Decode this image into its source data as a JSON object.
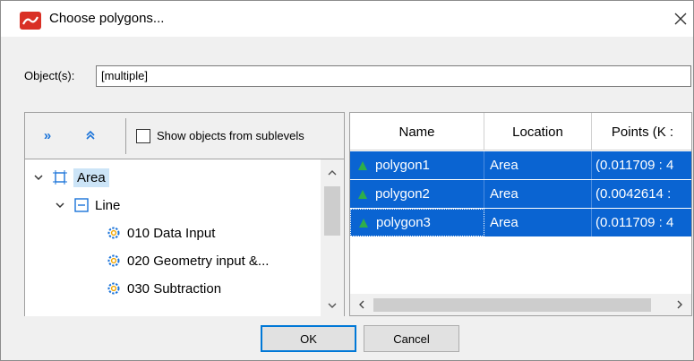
{
  "window": {
    "title": "Choose polygons...",
    "close_icon": "close-icon",
    "app_icon": "app-logo-icon",
    "accent": "#d93025"
  },
  "object": {
    "label": "Object(s):",
    "value": "[multiple]"
  },
  "toolbar": {
    "expand_all": "»",
    "collapse_all": "⌃",
    "show_sublevels_label": "Show objects from sublevels",
    "show_sublevels_checked": false
  },
  "tree": {
    "items": [
      {
        "label": "Area",
        "level": 0,
        "icon": "area-icon",
        "expanded": true,
        "selected": true
      },
      {
        "label": "Line",
        "level": 1,
        "icon": "line-icon",
        "expanded": true,
        "selected": false
      },
      {
        "label": "010 Data Input",
        "level": 2,
        "icon": "gear-icon",
        "selected": false
      },
      {
        "label": "020 Geometry input &...",
        "level": 2,
        "icon": "gear-icon",
        "selected": false
      },
      {
        "label": "030 Subtraction",
        "level": 2,
        "icon": "gear-icon",
        "selected": false
      }
    ]
  },
  "table": {
    "columns": [
      "Name",
      "Location",
      "Points (K :"
    ],
    "rows": [
      {
        "name": "polygon1",
        "location": "Area",
        "points": "(0.011709 : 4"
      },
      {
        "name": "polygon2",
        "location": "Area",
        "points": "(0.0042614 :"
      },
      {
        "name": "polygon3",
        "location": "Area",
        "points": "(0.011709 : 4"
      }
    ],
    "selection_color": "#0a64d2",
    "icon_color": "#2fae4a"
  },
  "buttons": {
    "ok": "OK",
    "cancel": "Cancel"
  }
}
